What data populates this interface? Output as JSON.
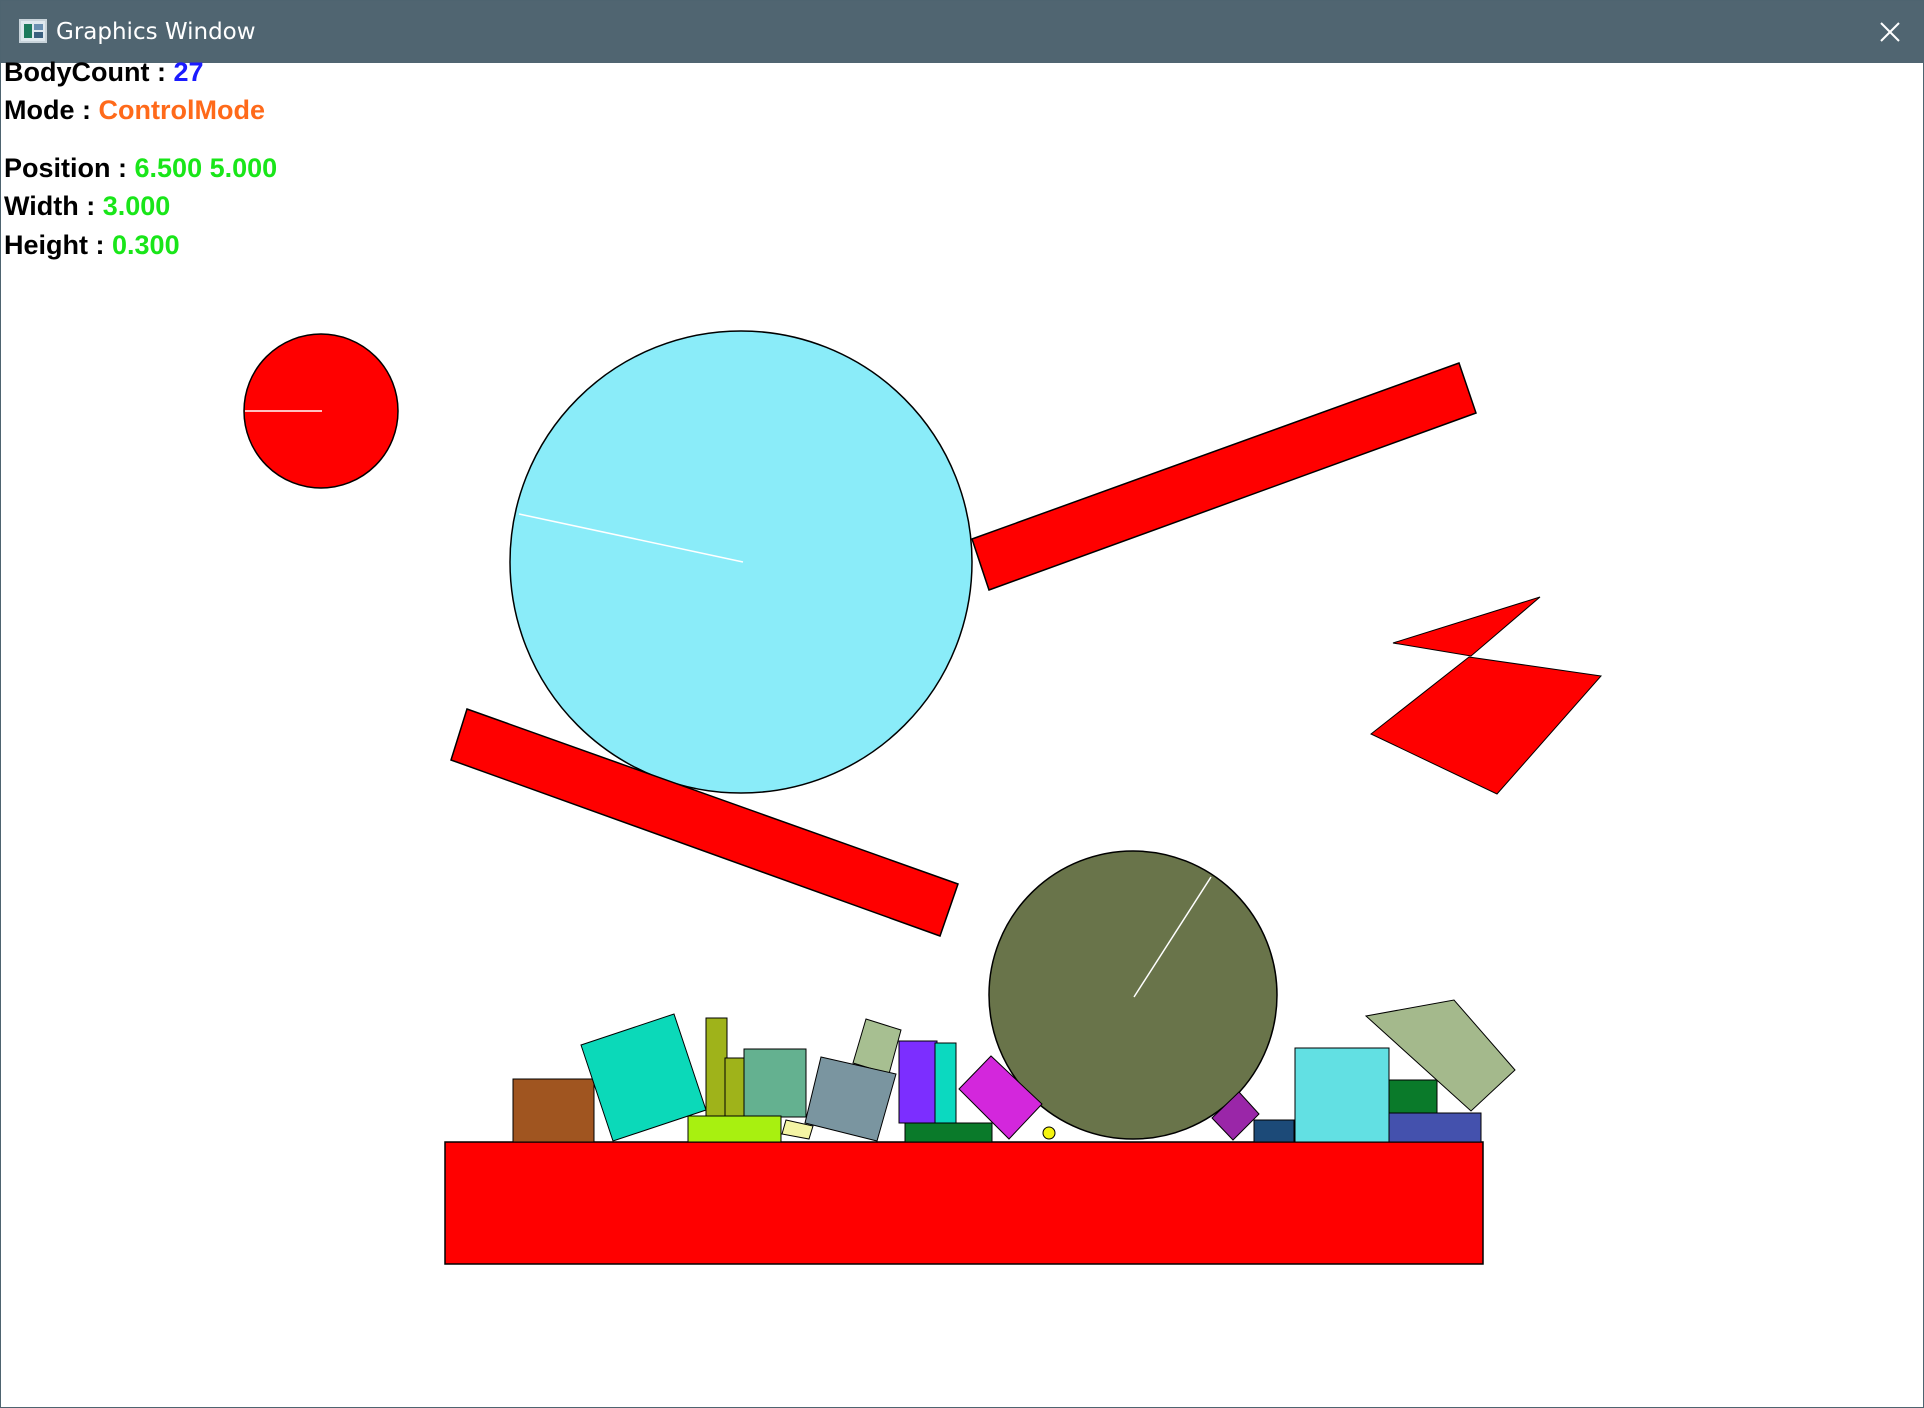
{
  "window": {
    "title": "Graphics Window",
    "icon": "graphics-window-icon",
    "close_icon": "close-icon"
  },
  "hud": {
    "body_count_label": "BodyCount :",
    "body_count_value": "27",
    "mode_label": "Mode :",
    "mode_value": "ControlMode",
    "position_label": "Position :",
    "position_value": "6.500 5.000",
    "width_label": "Width :",
    "width_value": "3.000",
    "height_label": "Height :",
    "height_value": "0.300"
  },
  "colors": {
    "titlebar": "#506571",
    "red": "#ff0000",
    "cyan_ball": "#8aecf9",
    "olive_ball": "#69744a",
    "value_blue": "#1b1bff",
    "value_orange": "#ff6a1a",
    "value_green": "#19e619"
  }
}
